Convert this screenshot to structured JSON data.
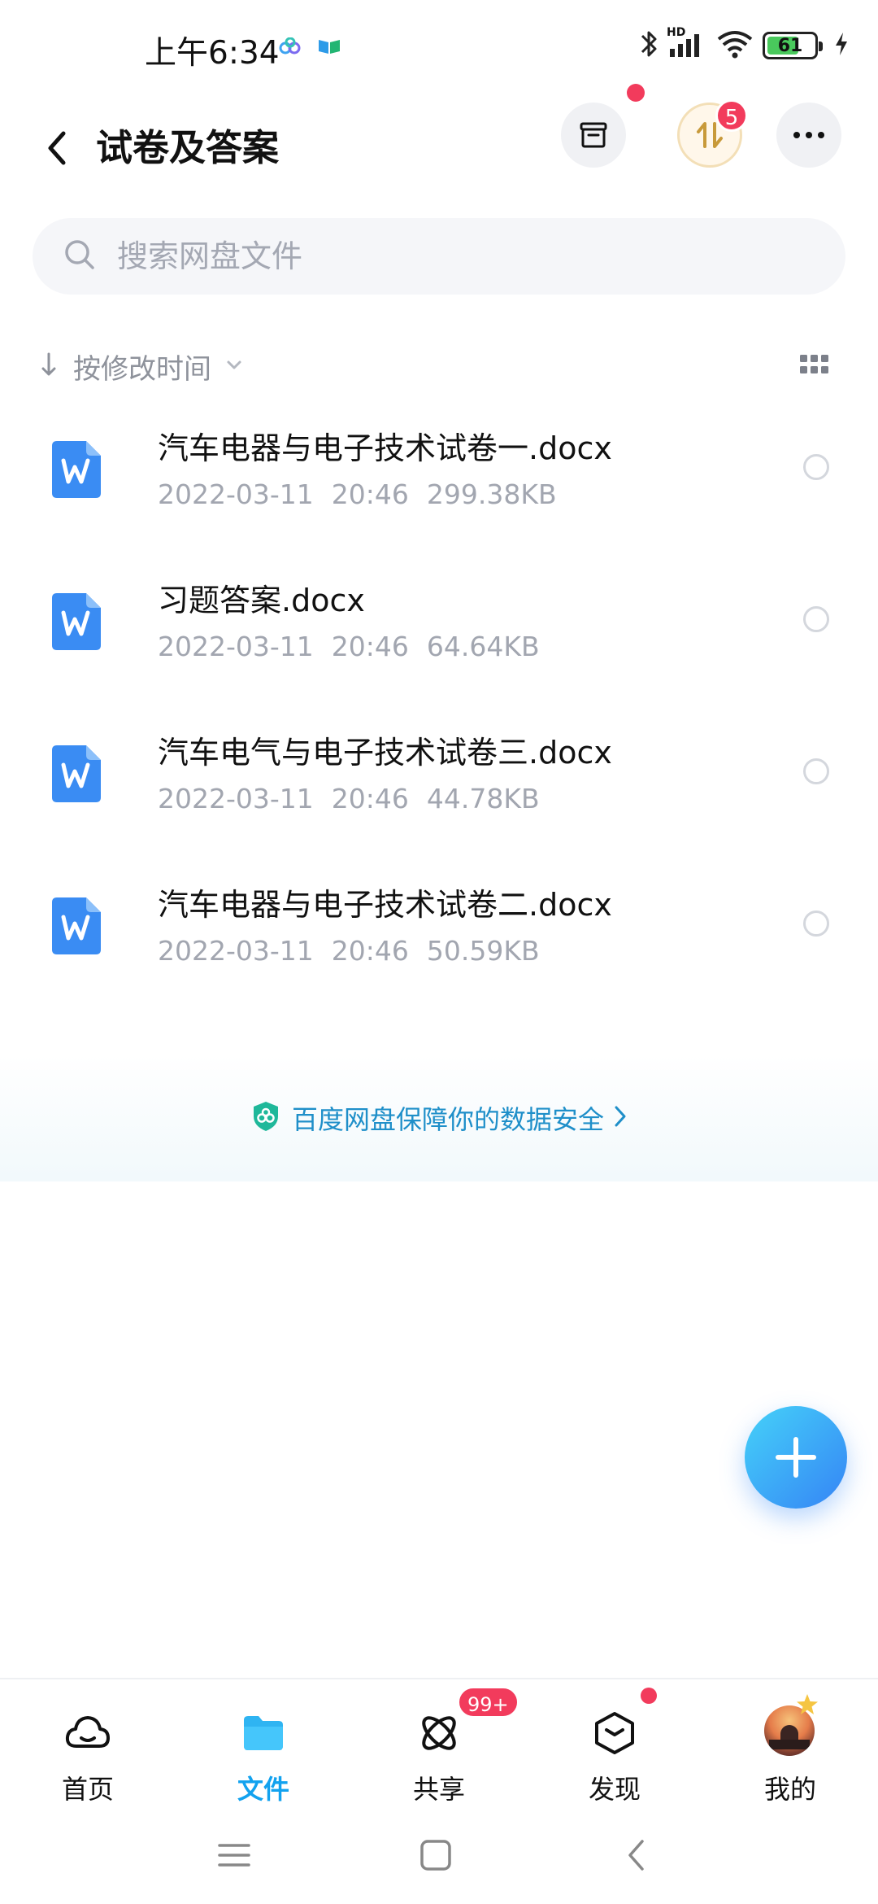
{
  "status_bar": {
    "time": "上午6:34",
    "battery_level": "61",
    "hd_label": "HD",
    "icons": [
      "bluetooth-icon",
      "cellular-signal-icon",
      "wifi-icon",
      "battery-icon",
      "charging-icon"
    ]
  },
  "header": {
    "title": "试卷及答案",
    "transfer_badge": "5"
  },
  "search": {
    "placeholder": "搜索网盘文件"
  },
  "sort": {
    "label": "按修改时间"
  },
  "files": [
    {
      "name": "汽车电器与电子技术试卷一.docx",
      "date": "2022-03-11",
      "time": "20:46",
      "size": "299.38KB"
    },
    {
      "name": "习题答案.docx",
      "date": "2022-03-11",
      "time": "20:46",
      "size": "64.64KB"
    },
    {
      "name": "汽车电气与电子技术试卷三.docx",
      "date": "2022-03-11",
      "time": "20:46",
      "size": "44.78KB"
    },
    {
      "name": "汽车电器与电子技术试卷二.docx",
      "date": "2022-03-11",
      "time": "20:46",
      "size": "50.59KB"
    }
  ],
  "banner": {
    "text": "百度网盘保障你的数据安全"
  },
  "bottom_nav": {
    "items": [
      {
        "label": "首页",
        "icon": "cloud-home-icon"
      },
      {
        "label": "文件",
        "icon": "folder-icon"
      },
      {
        "label": "共享",
        "icon": "share-icon"
      },
      {
        "label": "发现",
        "icon": "discover-icon"
      },
      {
        "label": "我的",
        "icon": "avatar"
      }
    ],
    "share_badge": "99+",
    "active_index": 1
  },
  "colors": {
    "accent": "#12a2ef",
    "badge": "#f23b5c",
    "docx_icon": "#3a8cf3",
    "meta_text": "#a2a6b0"
  }
}
